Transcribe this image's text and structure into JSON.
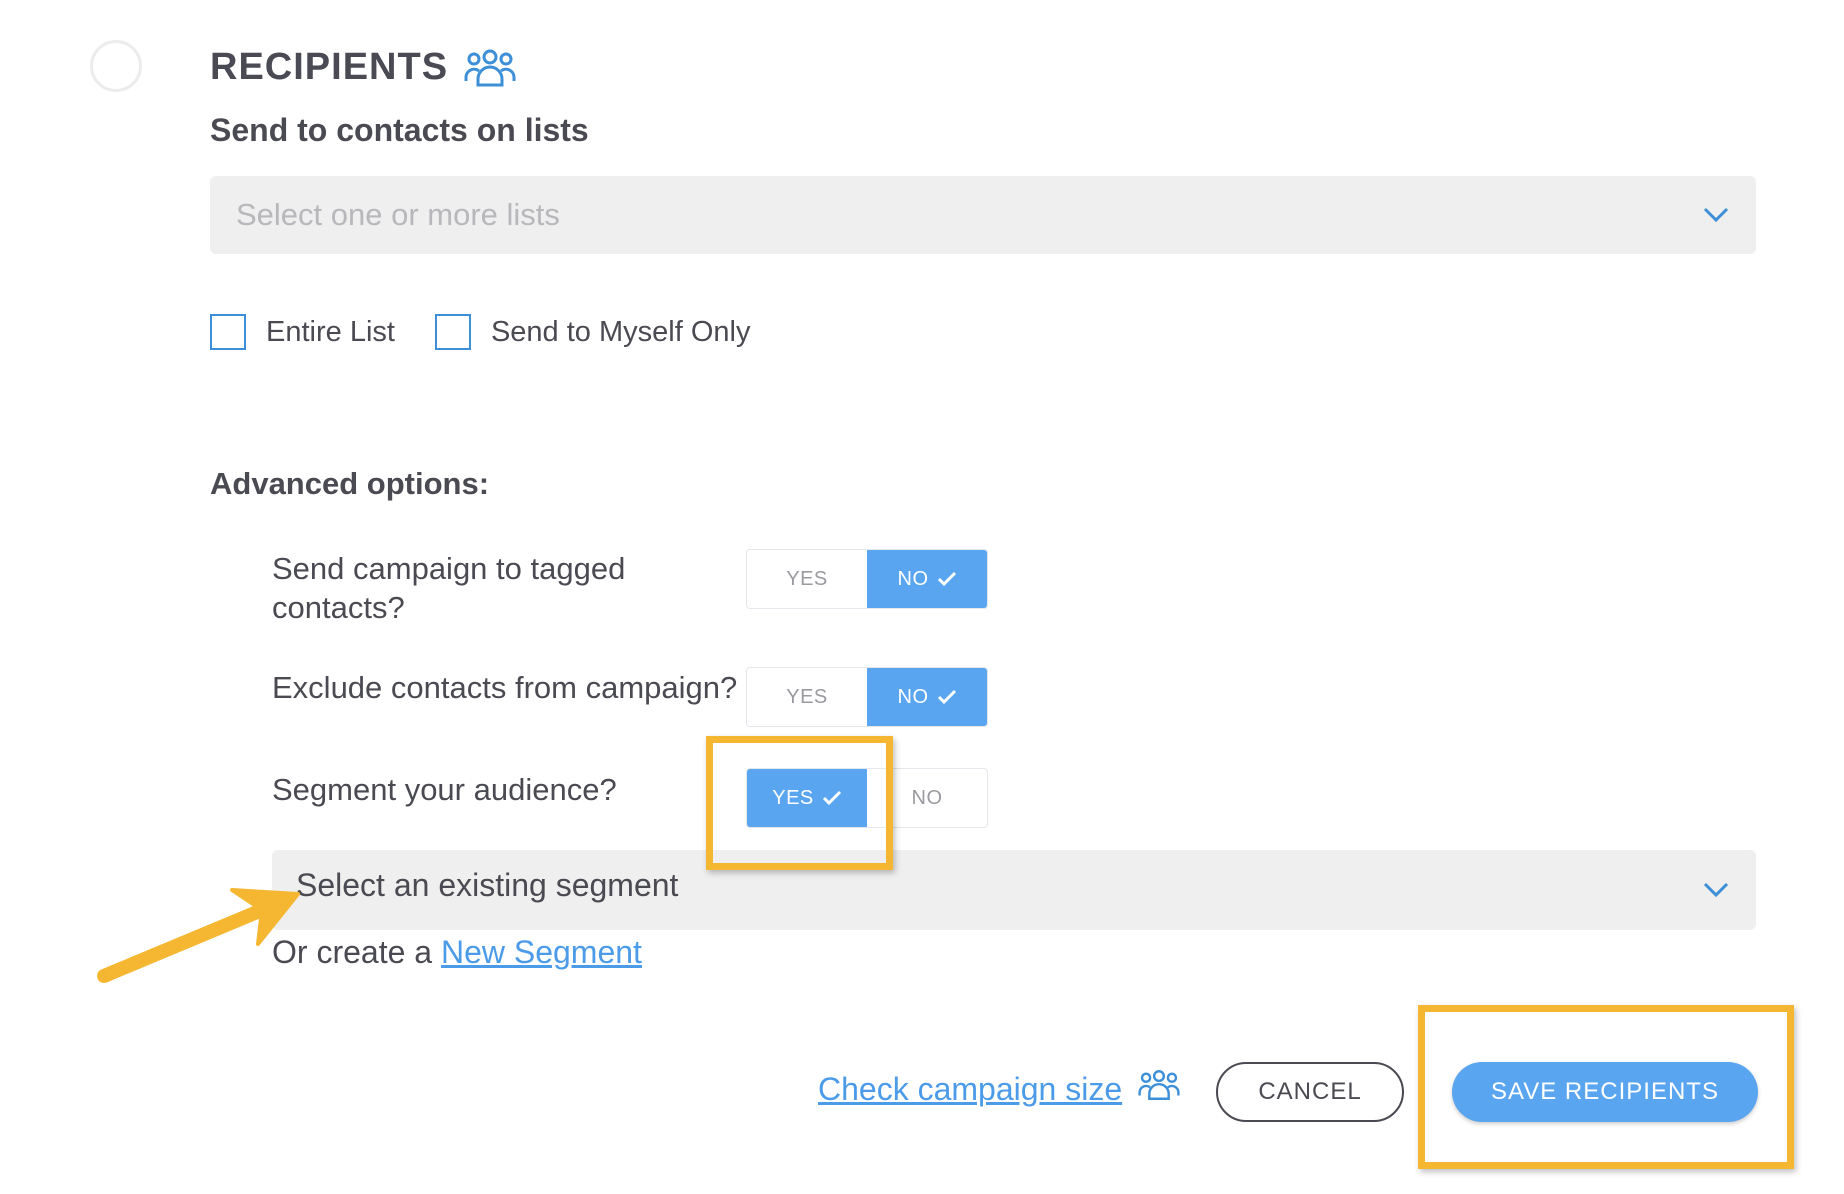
{
  "section": {
    "title": "RECIPIENTS",
    "icon": "people-group-icon"
  },
  "lists": {
    "subtitle": "Send to contacts on lists",
    "placeholder": "Select one or more lists",
    "checkboxes": [
      {
        "label": "Entire List",
        "checked": false
      },
      {
        "label": "Send to Myself Only",
        "checked": false
      }
    ]
  },
  "advanced": {
    "title": "Advanced options:",
    "questions": [
      {
        "label": "Send campaign to tagged contacts?",
        "yes": "YES",
        "no": "NO",
        "selected": "NO"
      },
      {
        "label": "Exclude contacts from campaign?",
        "yes": "YES",
        "no": "NO",
        "selected": "NO"
      },
      {
        "label": "Segment your audience?",
        "yes": "YES",
        "no": "NO",
        "selected": "YES"
      }
    ],
    "segment_select": "Select an existing segment",
    "create_prefix": "Or create a",
    "create_link": "New Segment"
  },
  "footer": {
    "check_size": "Check campaign size",
    "cancel": "CANCEL",
    "save": "SAVE RECIPIENTS"
  },
  "colors": {
    "accent": "#5aa5f0",
    "link": "#4c9be8",
    "highlight": "#f5b731",
    "text": "#4a4a52"
  }
}
